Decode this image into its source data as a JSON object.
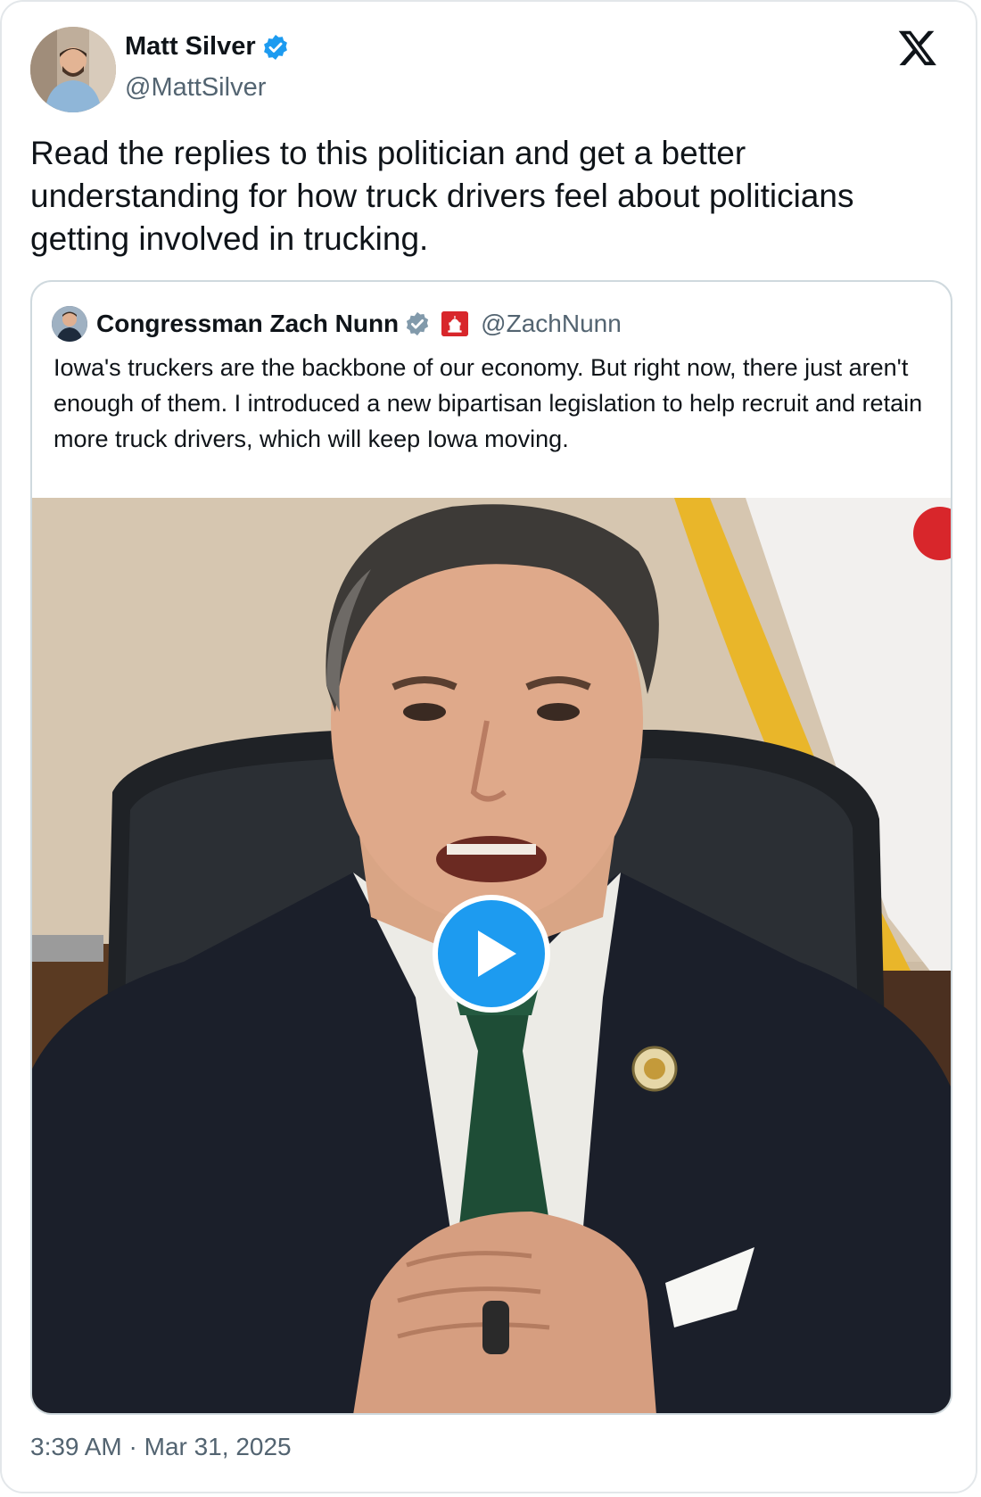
{
  "author": {
    "name": "Matt Silver",
    "handle": "@MattSilver",
    "verified": true,
    "avatar_icon": "person-photo"
  },
  "tweet": {
    "text": "Read the replies to this politician and get a better understanding for how truck drivers feel about politicians getting involved in trucking.",
    "timestamp": "3:39 AM · Mar 31, 2025"
  },
  "quoted": {
    "name": "Congressman Zach Nunn",
    "handle": "@ZachNunn",
    "verified": true,
    "badge_icon": "capitol-affiliation-badge",
    "text": "Iowa's truckers are the backbone of our economy. But right now, there just aren't enough of them. I introduced a new bipartisan legislation to help recruit and retain more truck drivers, which will keep Iowa moving.",
    "media": {
      "type": "video",
      "play_icon": "play-icon"
    }
  },
  "brand": {
    "logo": "x-logo",
    "verified_color": "#1d9bf0",
    "gov_verified_color": "#829aab"
  }
}
